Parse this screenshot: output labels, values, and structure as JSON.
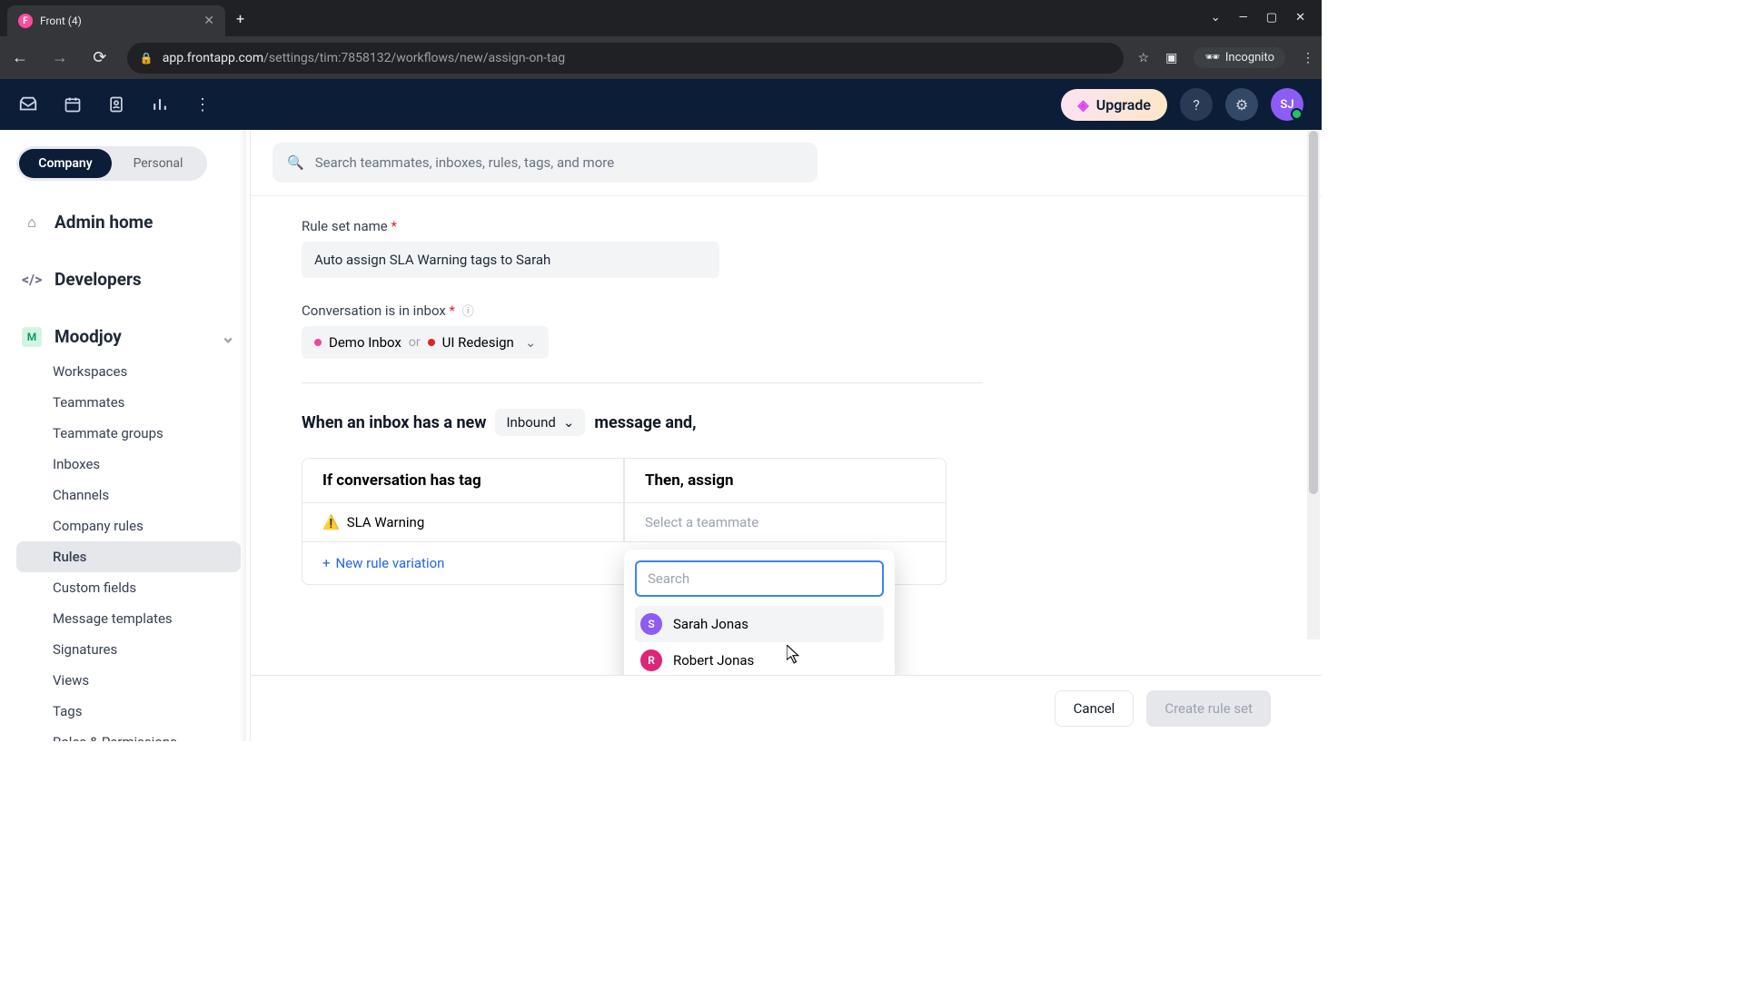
{
  "browser": {
    "tab_title": "Front (4)",
    "url_domain": "app.frontapp.com",
    "url_path": "/settings/tim:7858132/workflows/new/assign-on-tag",
    "incognito": "Incognito"
  },
  "header": {
    "upgrade": "Upgrade",
    "avatar_initials": "SJ"
  },
  "sidebar": {
    "scope_company": "Company",
    "scope_personal": "Personal",
    "admin_home": "Admin home",
    "developers": "Developers",
    "workspace_badge": "M",
    "workspace_name": "Moodjoy",
    "items": {
      "workspaces": "Workspaces",
      "teammates": "Teammates",
      "teammate_groups": "Teammate groups",
      "inboxes": "Inboxes",
      "channels": "Channels",
      "company_rules": "Company rules",
      "rules": "Rules",
      "custom_fields": "Custom fields",
      "message_templates": "Message templates",
      "signatures": "Signatures",
      "views": "Views",
      "tags": "Tags",
      "roles": "Roles & Permissions"
    }
  },
  "search": {
    "placeholder": "Search teammates, inboxes, rules, tags, and more"
  },
  "form": {
    "rule_name_label": "Rule set name",
    "rule_name_value": "Auto assign SLA Warning tags to Sarah",
    "inbox_label": "Conversation is in inbox",
    "inbox1": "Demo Inbox",
    "or": "or",
    "inbox2": "UI Redesign",
    "trigger_prefix": "When an inbox has a new",
    "trigger_mode": "Inbound",
    "trigger_suffix": "message and,",
    "col_if": "If conversation has tag",
    "col_then": "Then, assign",
    "tag_emoji": "⚠️",
    "tag_name": "SLA Warning",
    "select_placeholder": "Select a teammate",
    "new_variation": "New rule variation"
  },
  "dropdown": {
    "search_placeholder": "Search",
    "options": [
      {
        "initial": "S",
        "name": "Sarah Jonas",
        "color": "purple"
      },
      {
        "initial": "R",
        "name": "Robert Jonas",
        "color": "pink"
      }
    ]
  },
  "footer": {
    "cancel": "Cancel",
    "create": "Create rule set"
  }
}
